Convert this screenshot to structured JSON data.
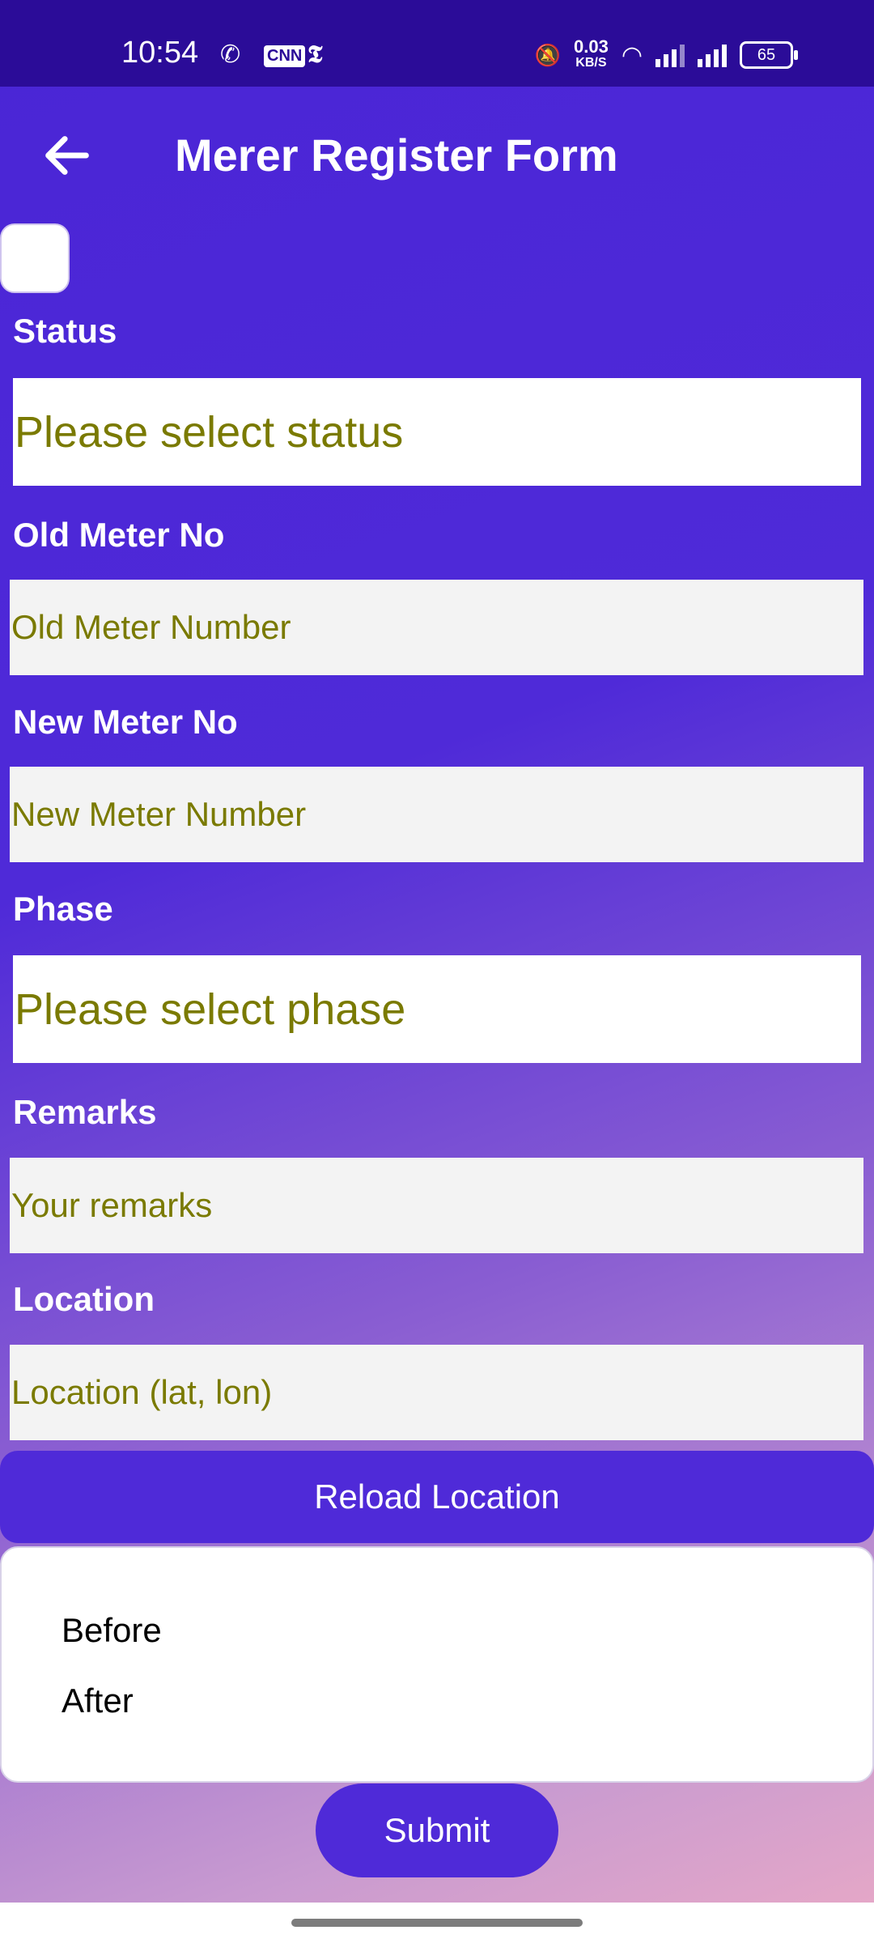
{
  "status_bar": {
    "time": "10:54",
    "net_speed": "0.03",
    "net_unit": "KB/S",
    "battery": "65",
    "icons": [
      "whatsapp-icon",
      "cnn-icon",
      "nyt-icon",
      "mute-icon",
      "wifi-icon",
      "signal-icon"
    ]
  },
  "app_bar": {
    "title": "Merer Register Form"
  },
  "form": {
    "status_label": "Status",
    "status_placeholder": "Please select status",
    "old_meter_label": "Old Meter No",
    "old_meter_placeholder": "Old Meter Number",
    "new_meter_label": "New Meter No",
    "new_meter_placeholder": "New Meter Number",
    "phase_label": "Phase",
    "phase_placeholder": "Please select phase",
    "remarks_label": "Remarks",
    "remarks_placeholder": "Your remarks",
    "location_label": "Location",
    "location_placeholder": "Location (lat, lon)",
    "reload_button": "Reload Location",
    "photo_items": [
      "Before",
      "After"
    ],
    "submit_button": "Submit"
  },
  "colors": {
    "status_bar": "#2b0c98",
    "accent": "#4f2ad8",
    "placeholder_text": "#7a7a00",
    "input_bg": "#f3f3f3"
  }
}
